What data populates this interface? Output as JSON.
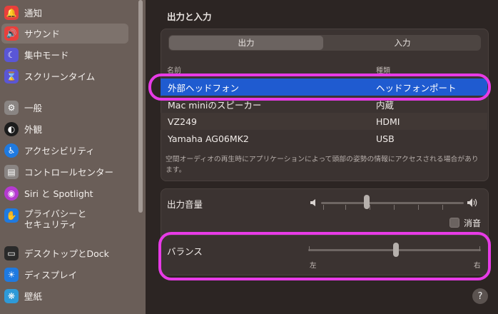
{
  "sidebar": {
    "items": [
      {
        "label": "通知",
        "icon": "bell-icon",
        "color": "#e8403c",
        "glyph": "🔔"
      },
      {
        "label": "サウンド",
        "icon": "speaker-icon",
        "color": "#e8403c",
        "glyph": "🔊"
      },
      {
        "label": "集中モード",
        "icon": "moon-icon",
        "color": "#5a56d6",
        "glyph": "☾"
      },
      {
        "label": "スクリーンタイム",
        "icon": "hourglass-icon",
        "color": "#5a56d6",
        "glyph": "⏳"
      },
      {
        "label": "一般",
        "icon": "gear-icon",
        "color": "#8a8583",
        "glyph": "⚙"
      },
      {
        "label": "外観",
        "icon": "appearance-icon",
        "color": "#1c1c1c",
        "glyph": "◐"
      },
      {
        "label": "アクセシビリティ",
        "icon": "accessibility-icon",
        "color": "#1f7ae0",
        "glyph": "♿"
      },
      {
        "label": "コントロールセンター",
        "icon": "control-center-icon",
        "color": "#8a8583",
        "glyph": "▤"
      },
      {
        "label": "Siri と Spotlight",
        "icon": "siri-icon",
        "color": "#b53ad0",
        "glyph": "◉"
      },
      {
        "label": "プライバシーと\nセキュリティ",
        "icon": "privacy-hand-icon",
        "color": "#1f7ae0",
        "glyph": "✋"
      },
      {
        "label": "デスクトップとDock",
        "icon": "dock-icon",
        "color": "#2a2a2a",
        "glyph": "▭"
      },
      {
        "label": "ディスプレイ",
        "icon": "display-sun-icon",
        "color": "#1f7ae0",
        "glyph": "☀"
      },
      {
        "label": "壁紙",
        "icon": "wallpaper-icon",
        "color": "#2e9ad8",
        "glyph": "❋"
      }
    ]
  },
  "main": {
    "title": "出力と入力",
    "tabs": [
      {
        "label": "出力"
      },
      {
        "label": "入力"
      }
    ],
    "columns": [
      "名前",
      "種類"
    ],
    "devices": [
      {
        "name": "外部ヘッドフォン",
        "type": "ヘッドフォンポート"
      },
      {
        "name": "Mac miniのスピーカー",
        "type": "内蔵"
      },
      {
        "name": "VZ249",
        "type": "HDMI"
      },
      {
        "name": "Yamaha AG06MK2",
        "type": "USB"
      }
    ],
    "note": "空間オーディオの再生時にアプリケーションによって頭部の姿勢の情報にアクセスされる場合があります。",
    "volume_label": "出力音量",
    "mute_label": "消音",
    "balance_label": "バランス",
    "balance_left": "左",
    "balance_right": "右",
    "help": "?"
  },
  "colors": {
    "accent": "#1f5bd0",
    "highlight": "#e73be6"
  }
}
